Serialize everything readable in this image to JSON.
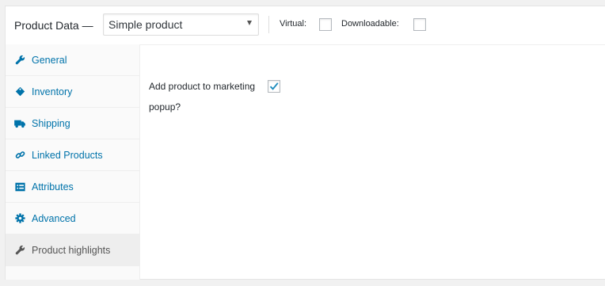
{
  "header": {
    "title": "Product Data —",
    "product_type": "Simple product",
    "virtual_label": "Virtual:",
    "downloadable_label": "Downloadable:"
  },
  "tabs": [
    {
      "label": "General",
      "icon": "wrench-icon"
    },
    {
      "label": "Inventory",
      "icon": "tag-icon"
    },
    {
      "label": "Shipping",
      "icon": "truck-icon"
    },
    {
      "label": "Linked Products",
      "icon": "link-icon"
    },
    {
      "label": "Attributes",
      "icon": "list-icon"
    },
    {
      "label": "Advanced",
      "icon": "gear-icon"
    },
    {
      "label": "Product highlights",
      "icon": "wrench-icon"
    }
  ],
  "active_tab": "Product highlights",
  "content": {
    "marketing_popup_label": "Add product to marketing popup?",
    "marketing_popup_checked": true
  },
  "colors": {
    "link": "#0073aa",
    "check": "#1e8cbe",
    "active_tab_bg": "#eeeeee"
  }
}
